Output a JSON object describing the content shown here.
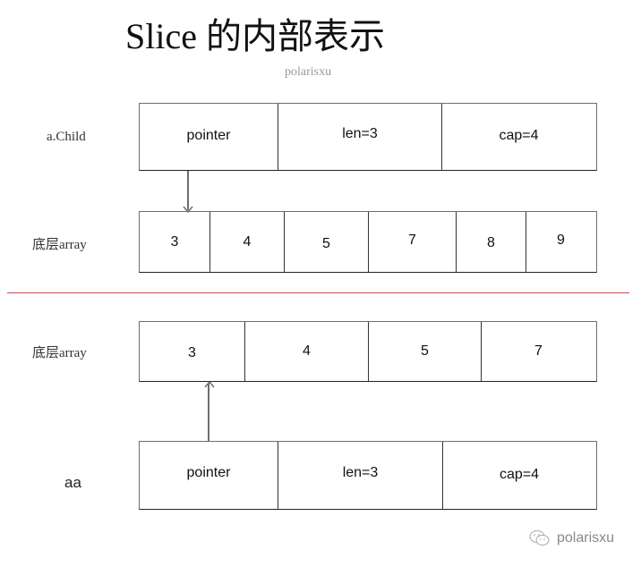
{
  "title": "Slice 的内部表示",
  "subtitle": "polarisxu",
  "top_section": {
    "slice_label": "a.Child",
    "slice_fields": [
      "pointer",
      "len=3",
      "cap=4"
    ],
    "array_label": "底层array",
    "array_values": [
      "3",
      "4",
      "5",
      "7",
      "8",
      "9"
    ]
  },
  "bottom_section": {
    "array_label": "底层array",
    "array_values": [
      "3",
      "4",
      "5",
      "7"
    ],
    "slice_label": "aa",
    "slice_fields": [
      "pointer",
      "len=3",
      "cap=4"
    ]
  },
  "watermark": {
    "icon": "wechat-icon",
    "text": "polarisxu"
  },
  "colors": {
    "divider": "#c44b4b",
    "border": "#6e6e6e",
    "watermark": "#8a8a8a"
  }
}
